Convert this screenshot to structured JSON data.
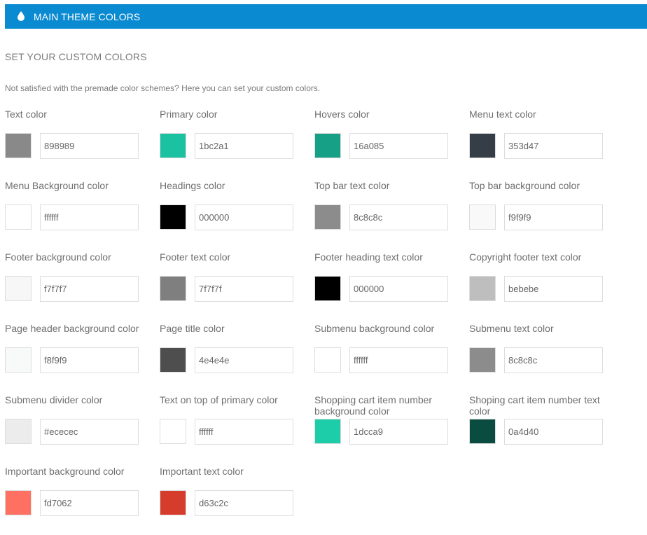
{
  "header": {
    "title": "MAIN THEME COLORS",
    "icon": "drop-icon"
  },
  "section": {
    "title": "SET YOUR CUSTOM COLORS",
    "description": "Not satisfied with the premade color schemes? Here you can set your custom colors."
  },
  "colors": [
    {
      "label": "Text color",
      "value": "898989",
      "swatch": "#898989"
    },
    {
      "label": "Primary color",
      "value": "1bc2a1",
      "swatch": "#1bc2a1"
    },
    {
      "label": "Hovers color",
      "value": "16a085",
      "swatch": "#16a085"
    },
    {
      "label": "Menu text color",
      "value": "353d47",
      "swatch": "#353d47"
    },
    {
      "label": "Menu Background color",
      "value": "ffffff",
      "swatch": "#ffffff"
    },
    {
      "label": "Headings color",
      "value": "000000",
      "swatch": "#000000"
    },
    {
      "label": "Top bar text color",
      "value": "8c8c8c",
      "swatch": "#8c8c8c"
    },
    {
      "label": "Top bar background color",
      "value": "f9f9f9",
      "swatch": "#f9f9f9"
    },
    {
      "label": "Footer background color",
      "value": "f7f7f7",
      "swatch": "#f7f7f7"
    },
    {
      "label": "Footer text color",
      "value": "7f7f7f",
      "swatch": "#7f7f7f"
    },
    {
      "label": "Footer heading text color",
      "value": "000000",
      "swatch": "#000000"
    },
    {
      "label": "Copyright footer text color",
      "value": "bebebe",
      "swatch": "#bebebe"
    },
    {
      "label": "Page header background color",
      "value": "f8f9f9",
      "swatch": "#f8f9f9"
    },
    {
      "label": "Page title color",
      "value": "4e4e4e",
      "swatch": "#4e4e4e"
    },
    {
      "label": "Submenu background color",
      "value": "ffffff",
      "swatch": "#ffffff"
    },
    {
      "label": "Submenu text color",
      "value": "8c8c8c",
      "swatch": "#8c8c8c"
    },
    {
      "label": "Submenu divider color",
      "value": "#ececec",
      "swatch": "#ececec"
    },
    {
      "label": "Text on top of primary color",
      "value": "ffffff",
      "swatch": "#ffffff"
    },
    {
      "label": "Shopping cart item number background color",
      "value": "1dcca9",
      "swatch": "#1dcca9"
    },
    {
      "label": "Shoping cart item number text color",
      "value": "0a4d40",
      "swatch": "#0a4d40"
    },
    {
      "label": "Important background color",
      "value": "fd7062",
      "swatch": "#fd7062"
    },
    {
      "label": "Important text color",
      "value": "d63c2c",
      "swatch": "#d63c2c"
    }
  ],
  "theme": {
    "header_bg": "#0a8ad0",
    "header_text": "#ffffff"
  }
}
